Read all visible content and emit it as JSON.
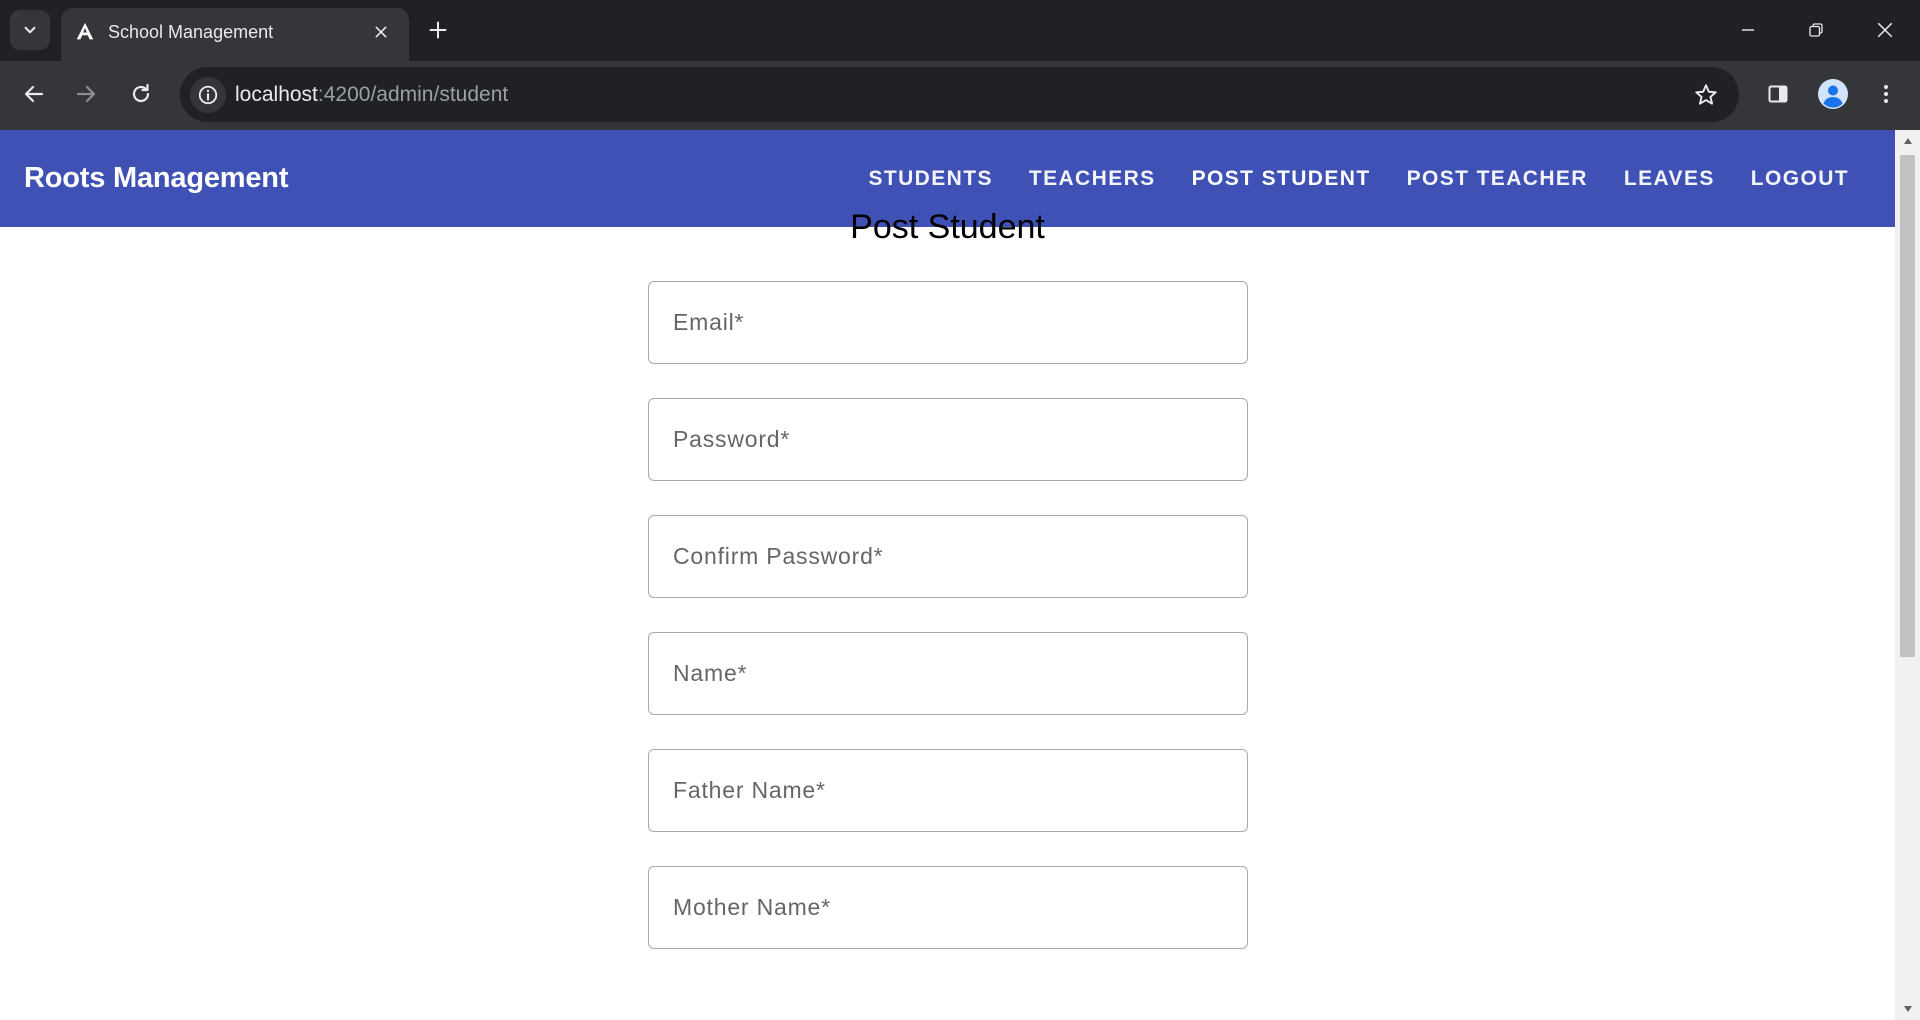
{
  "browser": {
    "tab_title": "School Management",
    "url_host": "localhost",
    "url_port": ":4200",
    "url_path": "/admin/student"
  },
  "app": {
    "brand": "Roots Management",
    "nav": [
      {
        "label": "STUDENTS",
        "active": false
      },
      {
        "label": "TEACHERS",
        "active": false
      },
      {
        "label": "POST STUDENT",
        "active": true
      },
      {
        "label": "POST TEACHER",
        "active": false
      },
      {
        "label": "LEAVES",
        "active": false
      },
      {
        "label": "LOGOUT",
        "active": false
      }
    ],
    "accent_color": "#3f51b5"
  },
  "form": {
    "title": "Post Student",
    "fields": [
      {
        "placeholder": "Email*",
        "value": ""
      },
      {
        "placeholder": "Password*",
        "value": ""
      },
      {
        "placeholder": "Confirm Password*",
        "value": ""
      },
      {
        "placeholder": "Name*",
        "value": ""
      },
      {
        "placeholder": "Father Name*",
        "value": ""
      },
      {
        "placeholder": "Mother Name*",
        "value": ""
      }
    ]
  }
}
